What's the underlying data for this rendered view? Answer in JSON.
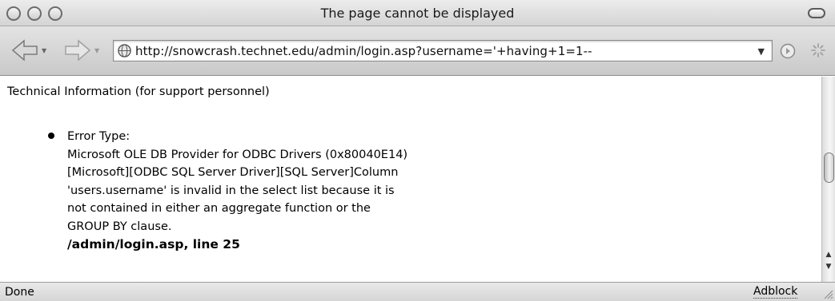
{
  "window": {
    "title": "The page cannot be displayed"
  },
  "toolbar": {
    "back_icon": "back-arrow-icon",
    "forward_icon": "forward-arrow-icon",
    "url": "http://snowcrash.technet.edu/admin/login.asp?username='+having+1=1--",
    "go_icon": "go-icon",
    "activity_icon": "loading-spinner-icon"
  },
  "content": {
    "technical_info": "Technical Information (for support personnel)",
    "error": {
      "type_label": "Error Type:",
      "lines": [
        "Microsoft OLE DB Provider for ODBC Drivers (0x80040E14)",
        "[Microsoft][ODBC SQL Server Driver][SQL Server]Column",
        "'users.username' is invalid in the select list because it is",
        "not contained in either an aggregate function or the",
        "GROUP BY clause."
      ],
      "location": "/admin/login.asp, line 25"
    }
  },
  "statusbar": {
    "status": "Done",
    "adblock": "Adblock"
  }
}
